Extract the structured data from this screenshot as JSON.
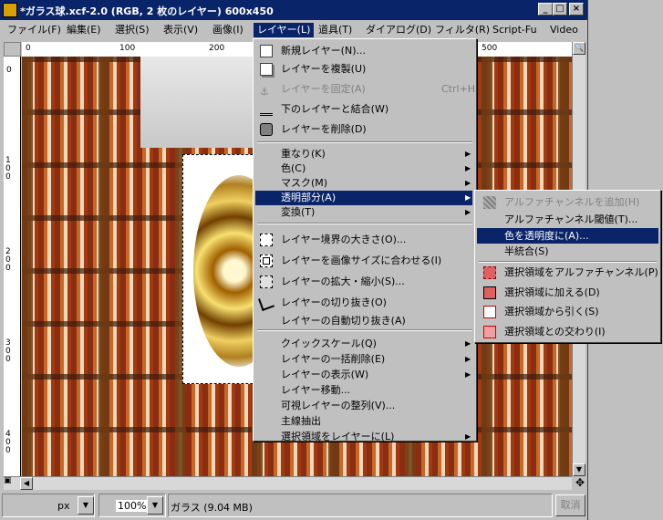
{
  "window": {
    "title": "*ガラス球.xcf-2.0 (RGB, 2 枚のレイヤー) 600x450"
  },
  "menubar": [
    "ファイル(F)",
    "編集(E)",
    "選択(S)",
    "表示(V)",
    "画像(I)",
    "レイヤー(L)",
    "道具(T)",
    "ダイアログ(D)",
    "フィルタ(R)",
    "Script-Fu",
    "Video"
  ],
  "ruler_h_labels": [
    "0",
    "100",
    "200",
    "500"
  ],
  "ruler_v_labels": [
    "0",
    "100",
    "200",
    "300",
    "400"
  ],
  "layer_menu": {
    "items": [
      {
        "label": "新規レイヤー(N)...",
        "accel": "",
        "icon": "new-layer-icon",
        "disabled": false,
        "submenu": false
      },
      {
        "label": "レイヤーを複製(U)",
        "accel": "",
        "icon": "duplicate-layer-icon",
        "disabled": false,
        "submenu": false
      },
      {
        "label": "レイヤーを固定(A)",
        "accel": "Ctrl+H",
        "icon": "anchor-icon",
        "disabled": true,
        "submenu": false
      },
      {
        "label": "下のレイヤーと結合(W)",
        "accel": "",
        "icon": "merge-down-icon",
        "disabled": false,
        "submenu": false
      },
      {
        "label": "レイヤーを削除(D)",
        "accel": "",
        "icon": "delete-layer-icon",
        "disabled": false,
        "submenu": false
      },
      {
        "label": "重なり(K)",
        "accel": "",
        "icon": "",
        "disabled": false,
        "submenu": true
      },
      {
        "label": "色(C)",
        "accel": "",
        "icon": "",
        "disabled": false,
        "submenu": true
      },
      {
        "label": "マスク(M)",
        "accel": "",
        "icon": "",
        "disabled": false,
        "submenu": true
      },
      {
        "label": "透明部分(A)",
        "accel": "",
        "icon": "",
        "disabled": false,
        "submenu": true
      },
      {
        "label": "変換(T)",
        "accel": "",
        "icon": "",
        "disabled": false,
        "submenu": true
      },
      {
        "label": "レイヤー境界の大きさ(O)...",
        "accel": "",
        "icon": "layer-boundary-icon",
        "disabled": false,
        "submenu": false
      },
      {
        "label": "レイヤーを画像サイズに合わせる(I)",
        "accel": "",
        "icon": "layer-to-image-size-icon",
        "disabled": false,
        "submenu": false
      },
      {
        "label": "レイヤーの拡大・縮小(S)...",
        "accel": "",
        "icon": "scale-layer-icon",
        "disabled": false,
        "submenu": false
      },
      {
        "label": "レイヤーの切り抜き(O)",
        "accel": "",
        "icon": "crop-layer-icon",
        "disabled": false,
        "submenu": false
      },
      {
        "label": "レイヤーの自動切り抜き(A)",
        "accel": "",
        "icon": "",
        "disabled": false,
        "submenu": false
      },
      {
        "label": "クイックスケール(Q)",
        "accel": "",
        "icon": "",
        "disabled": false,
        "submenu": true
      },
      {
        "label": "レイヤーの一括削除(E)",
        "accel": "",
        "icon": "",
        "disabled": false,
        "submenu": true
      },
      {
        "label": "レイヤーの表示(W)",
        "accel": "",
        "icon": "",
        "disabled": false,
        "submenu": true
      },
      {
        "label": "レイヤー移動...",
        "accel": "",
        "icon": "",
        "disabled": false,
        "submenu": false
      },
      {
        "label": "可視レイヤーの整列(V)...",
        "accel": "",
        "icon": "",
        "disabled": false,
        "submenu": false
      },
      {
        "label": "主線抽出",
        "accel": "",
        "icon": "",
        "disabled": false,
        "submenu": false
      },
      {
        "label": "選択領域をレイヤーに(L)",
        "accel": "",
        "icon": "",
        "disabled": false,
        "submenu": true
      }
    ]
  },
  "transparency_menu": {
    "items": [
      {
        "label": "アルファチャンネルを追加(H)",
        "icon": "add-alpha-icon",
        "disabled": true
      },
      {
        "label": "アルファチャンネル閾値(T)...",
        "icon": "",
        "disabled": false
      },
      {
        "label": "色を透明度に(A)...",
        "icon": "",
        "disabled": false
      },
      {
        "label": "半統合(S)",
        "icon": "",
        "disabled": false
      },
      {
        "label": "選択領域をアルファチャンネル(P)",
        "icon": "selection-to-alpha-icon",
        "disabled": false
      },
      {
        "label": "選択領域に加える(D)",
        "icon": "add-selection-icon",
        "disabled": false
      },
      {
        "label": "選択領域から引く(S)",
        "icon": "subtract-selection-icon",
        "disabled": false
      },
      {
        "label": "選択領域との交わり(I)",
        "icon": "intersect-selection-icon",
        "disabled": false
      }
    ]
  },
  "status": {
    "unit": "px",
    "zoom": "100%",
    "layer_info": "ガラス (9.04 MB)",
    "cancel_label": "取消"
  },
  "colors": {
    "titlebar": "#0a246a",
    "selected": "#0a246a",
    "face": "#c0c0c0"
  }
}
